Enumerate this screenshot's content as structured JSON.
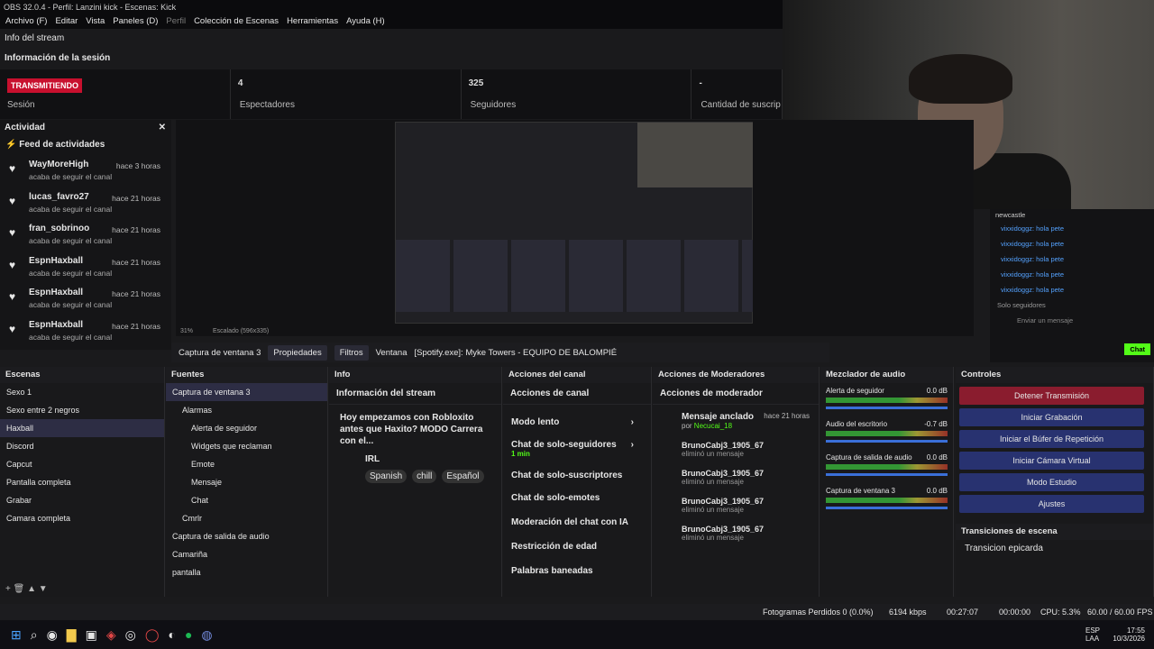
{
  "window": {
    "title": "OBS 32.0.4 - Perfil: Lanzini kick - Escenas: Kick"
  },
  "menu": [
    "Archivo (F)",
    "Editar",
    "Vista",
    "Paneles (D)",
    "Perfil",
    "Colección de Escenas",
    "Herramientas",
    "Ayuda (H)"
  ],
  "stream_info": {
    "title": "Info del stream",
    "section": "Información de la sesión",
    "live": "TRANSMITIENDO",
    "session": "Sesión",
    "viewers": "4",
    "viewers_label": "Espectadores",
    "followers": "325",
    "followers_label": "Seguidores",
    "subs": "-",
    "subs_label": "Cantidad de suscrip"
  },
  "activity": {
    "title": "Actividad",
    "feed": "Feed de actividades",
    "items": [
      {
        "name": "WayMoreHigh",
        "time": "hace 3 horas",
        "action": "acaba de seguir el canal"
      },
      {
        "name": "lucas_favro27",
        "time": "hace 21 horas",
        "action": "acaba de seguir el canal"
      },
      {
        "name": "fran_sobrinoo",
        "time": "hace 21 horas",
        "action": "acaba de seguir el canal"
      },
      {
        "name": "EspnHaxball",
        "time": "hace 21 horas",
        "action": "acaba de seguir el canal"
      },
      {
        "name": "EspnHaxball",
        "time": "hace 21 horas",
        "action": "acaba de seguir el canal"
      },
      {
        "name": "EspnHaxball",
        "time": "hace 21 horas",
        "action": "acaba de seguir el canal"
      }
    ]
  },
  "preview": {
    "zoom": "31%",
    "scale": "Escalado (596x335)"
  },
  "chat": {
    "lines": [
      "newcastle",
      "vixxidoggz: hola pete",
      "vixxidoggz: hola pete",
      "vixxidoggz: hola pete",
      "vixxidoggz: hola pete",
      "vixxidoggz: hola pete"
    ],
    "mode": "Solo seguidores",
    "placeholder": "Enviar un mensaje",
    "send": "Chat"
  },
  "toolbar": {
    "source": "Captura de ventana 3",
    "props": "Propiedades",
    "filters": "Filtros",
    "window_label": "Ventana",
    "window_value": "[Spotify.exe]: Myke Towers - EQUIPO DE BALOMPIÉ"
  },
  "scenes": {
    "title": "Escenas",
    "items": [
      "Sexo 1",
      "Sexo entre 2 negros",
      "Haxball",
      "Discord",
      "Capcut",
      "Pantalla completa",
      "Grabar",
      "Camara completa"
    ]
  },
  "sources": {
    "title": "Fuentes",
    "items": [
      "Captura de ventana 3",
      "Alarmas",
      "Alerta de seguidor",
      "Widgets que reclaman",
      "Emote",
      "Mensaje",
      "Chat",
      "Cmrlr",
      "Captura de salida de audio",
      "Camariña",
      "pantalla"
    ]
  },
  "info": {
    "title": "Info",
    "panel": "Información del stream",
    "stream_title": "Hoy empezamos con Robloxito antes que Haxito? MODO Carrera con el...",
    "category": "IRL",
    "tags": [
      "Spanish",
      "chill",
      "Español"
    ]
  },
  "channel": {
    "title": "Acciones del canal",
    "panel": "Acciones de canal",
    "items": [
      "Modo lento",
      "Chat de solo-seguidores",
      "Chat de solo-suscriptores",
      "Chat de solo-emotes",
      "Moderación del chat con IA",
      "Restricción de edad",
      "Palabras baneadas"
    ],
    "sub": "1 min"
  },
  "mods": {
    "title": "Acciones de Moderadores",
    "panel": "Acciones de moderador",
    "pinned": "Mensaje anclado",
    "pinned_time": "hace 21 horas",
    "pinned_by": "por",
    "pinned_user": "Necucai_18",
    "entries": [
      {
        "user": "BrunoCabj3_1905_67",
        "time": "hace 21 horas",
        "action": "eliminó un mensaje"
      },
      {
        "user": "BrunoCabj3_1905_67",
        "time": "hace 21 horas",
        "action": "eliminó un mensaje"
      },
      {
        "user": "BrunoCabj3_1905_67",
        "time": "hace 21 horas",
        "action": "eliminó un mensaje"
      },
      {
        "user": "BrunoCabj3_1905_67",
        "time": "hace 21 horas",
        "action": "eliminó un mensaje"
      }
    ]
  },
  "mixer": {
    "title": "Mezclador de audio",
    "channels": [
      {
        "name": "Alerta de seguidor",
        "db": "0.0 dB"
      },
      {
        "name": "Audio del escritorio",
        "db": "-0.7 dB"
      },
      {
        "name": "Captura de salida de audio",
        "db": "0.0 dB"
      },
      {
        "name": "Captura de ventana 3",
        "db": "0.0 dB"
      }
    ]
  },
  "controls": {
    "title": "Controles",
    "buttons": [
      "Detener Transmisión",
      "Iniciar Grabación",
      "Iniciar el Búfer de Repetición",
      "Iniciar Cámara Virtual",
      "Modo Estudio",
      "Ajustes"
    ],
    "trans_title": "Transiciones de escena",
    "transition": "Transicion epicarda"
  },
  "status": {
    "dropped": "Fotogramas Perdidos 0 (0.0%)",
    "bitrate": "6194 kbps",
    "stream_time": "00:27:07",
    "rec_time": "00:00:00",
    "cpu": "CPU: 5.3%",
    "fps": "60.00 / 60.00 FPS"
  },
  "taskbar": {
    "lang": "ESP",
    "lang2": "LAA",
    "time": "17:55",
    "date": "10/3/2026"
  },
  "colors": {
    "live": "#c8102e",
    "accent": "#283270",
    "green": "#53fc18"
  }
}
